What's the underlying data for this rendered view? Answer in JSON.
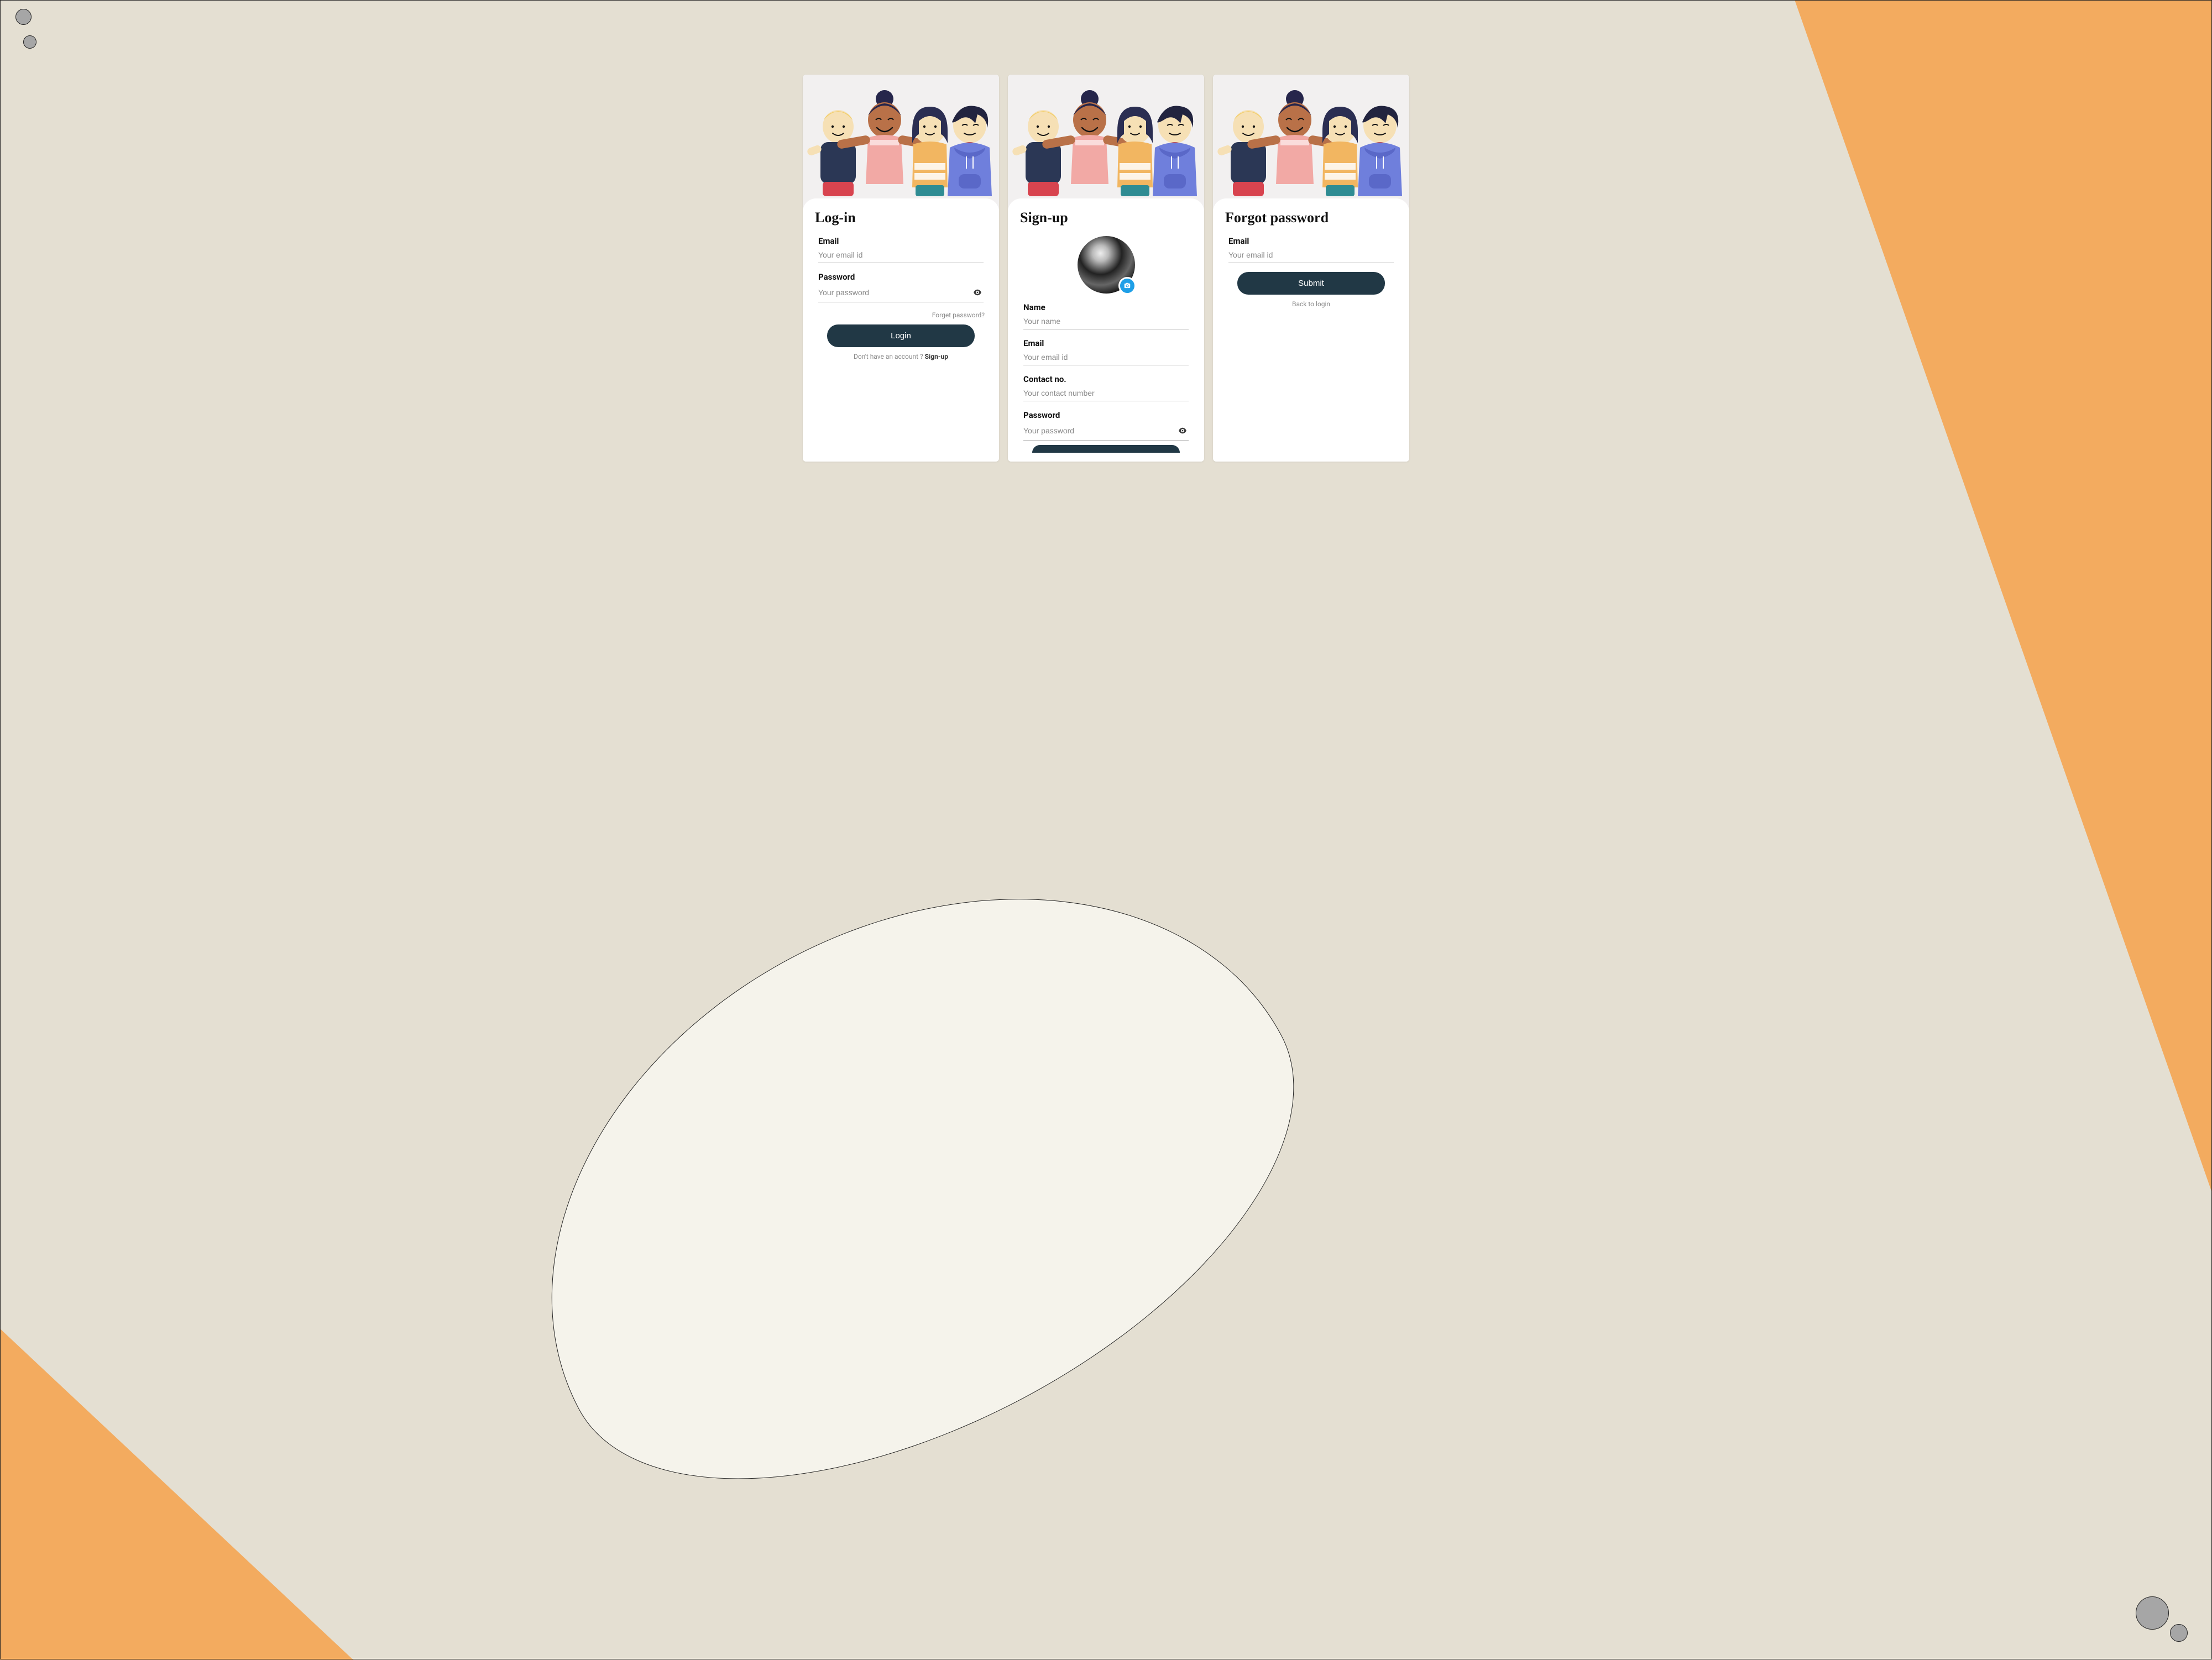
{
  "login": {
    "title": "Log-in",
    "email_label": "Email",
    "email_placeholder": "Your email id",
    "password_label": "Password",
    "password_placeholder": "Your password",
    "forgot_link": "Forget password?",
    "button": "Login",
    "below_prefix": "Don't have an account ? ",
    "below_action": "Sign-up"
  },
  "signup": {
    "title": "Sign-up",
    "name_label": "Name",
    "name_placeholder": "Your name",
    "email_label": "Email",
    "email_placeholder": "Your email id",
    "contact_label": "Contact no.",
    "contact_placeholder": "Your contact number",
    "password_label": "Password",
    "password_placeholder": "Your password"
  },
  "forgot": {
    "title": "Forgot password",
    "email_label": "Email",
    "email_placeholder": "Your email id",
    "button": "Submit",
    "back_link": "Back to login"
  },
  "colors": {
    "primary_button": "#213845",
    "accent_orange": "#F3AB5F",
    "bg": "#E4DFD2",
    "camera_badge": "#1E9FE7"
  }
}
